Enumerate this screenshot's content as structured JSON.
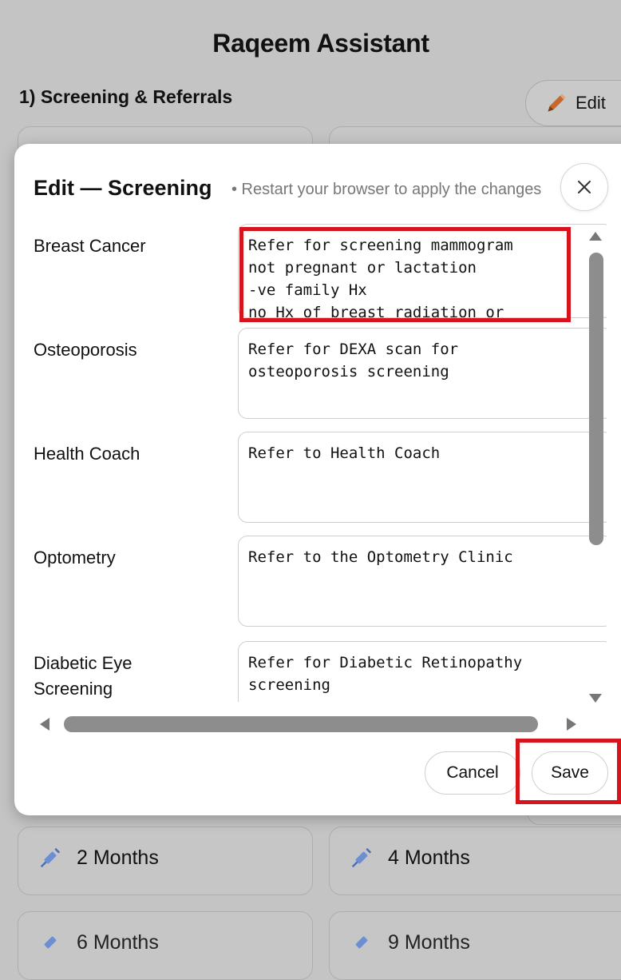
{
  "app": {
    "title": "Raqeem Assistant"
  },
  "section": {
    "title": "1) Screening & Referrals",
    "edit_label": "Edit"
  },
  "background_vaccines": [
    {
      "label": "2 Months",
      "icon": "syringe-icon"
    },
    {
      "label": "4 Months",
      "icon": "syringe-icon"
    },
    {
      "label": "6 Months",
      "icon": "syringe-icon"
    },
    {
      "label": "9 Months",
      "icon": "syringe-icon"
    }
  ],
  "modal": {
    "title": "Edit — Screening",
    "hint": "• Restart your browser to apply the changes",
    "close_icon": "close-icon",
    "fields": [
      {
        "label": "Breast Cancer",
        "value": "Refer for screening mammogram\nnot pregnant or lactation\n-ve family Hx\nno Hx of breast radiation or"
      },
      {
        "label": "Osteoporosis",
        "value": "Refer for DEXA scan for\nosteoporosis screening"
      },
      {
        "label": "Health Coach",
        "value": "Refer to Health Coach"
      },
      {
        "label": "Optometry",
        "value": "Refer to the Optometry Clinic"
      },
      {
        "label": "Diabetic Eye\nScreening",
        "value": "Refer for Diabetic Retinopathy\nscreening"
      }
    ],
    "cancel_label": "Cancel",
    "save_label": "Save"
  },
  "colors": {
    "overlay": "#c4c4c4",
    "highlight": "#d6141c",
    "edit_icon": "#c8692b",
    "syringe_icon": "#4a6fb3"
  }
}
